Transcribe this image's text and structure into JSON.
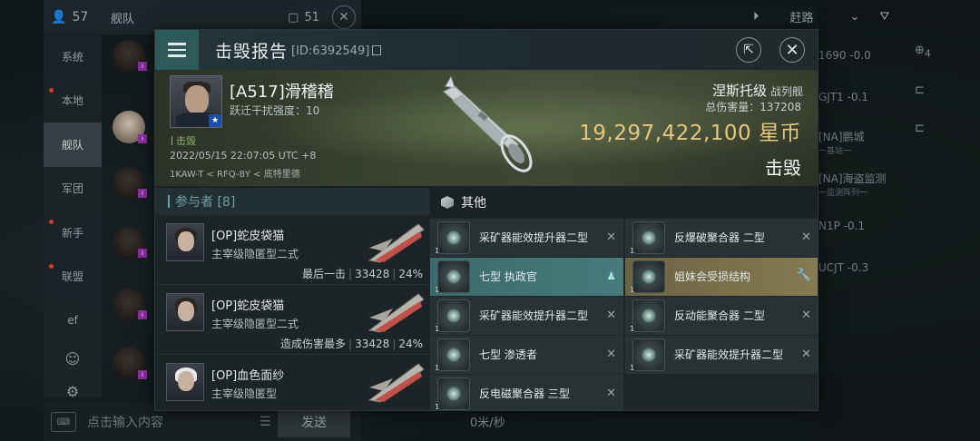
{
  "bg": {
    "player_count": "57",
    "channel": "舰队",
    "unread": "51",
    "nav": [
      "系统",
      "本地",
      "舰队",
      "军团",
      "新手",
      "联盟",
      "ef"
    ],
    "active_nav": "舰队",
    "input_placeholder": "点击输入内容",
    "send": "发送",
    "speed": "0米/秒",
    "route_label": "赶路",
    "right_rows": [
      {
        "main": "1690 -0.0",
        "sub": ""
      },
      {
        "main": "GJT1 -0.1",
        "sub": ""
      },
      {
        "main": "[NA]鹏城",
        "sub": "ー基站一"
      },
      {
        "main": "[NA]海盗监测",
        "sub": "一监测阵列一"
      },
      {
        "main": "N1P -0.1",
        "sub": ""
      },
      {
        "main": "UCJT -0.3",
        "sub": ""
      }
    ],
    "right_side_count": "4"
  },
  "report": {
    "title": "击毁报告",
    "id": "[ID:6392549]",
    "pilot_name": "[A517]滑稽稽",
    "warp_disrupt": "跃迁干扰强度：10",
    "status_tag": "击毁",
    "datetime": "2022/05/15 22:07:05 UTC +8",
    "location": "1KAW-T < RFQ-8Y < 底特里德",
    "ship_name": "涅斯托级",
    "ship_class": "战列舰",
    "total_damage": "总伤害量：137208",
    "isk_value": "19,297,422,100 星币",
    "result": "击毁"
  },
  "participants": {
    "header": "参与者 [8]",
    "rows": [
      {
        "name": "[OP]蛇皮袋猫",
        "ship": "主宰级隐匿型二式",
        "stat_label": "最后一击",
        "damage": "33428",
        "percent": "24%",
        "avatar": "dark"
      },
      {
        "name": "[OP]蛇皮袋猫",
        "ship": "主宰级隐匿型二式",
        "stat_label": "造成伤害最多",
        "damage": "33428",
        "percent": "24%",
        "avatar": "dark"
      },
      {
        "name": "[OP]血色面纱",
        "ship": "主宰级隐匿型",
        "stat_label": "",
        "damage": "",
        "percent": "",
        "avatar": "white"
      }
    ]
  },
  "others": {
    "header": "其他",
    "items": [
      {
        "label": "采矿器能效提升器二型",
        "qty": "1",
        "state": "destroyed",
        "action": "✕"
      },
      {
        "label": "反爆破聚合器 二型",
        "qty": "1",
        "state": "destroyed",
        "action": "✕"
      },
      {
        "label": "七型 执政官",
        "qty": "1",
        "state": "teal",
        "action": "person"
      },
      {
        "label": "姐妹会受损结构",
        "qty": "1",
        "state": "gold",
        "action": "wrench"
      },
      {
        "label": "采矿器能效提升器二型",
        "qty": "1",
        "state": "destroyed",
        "action": "✕"
      },
      {
        "label": "反动能聚合器 二型",
        "qty": "1",
        "state": "destroyed",
        "action": "✕"
      },
      {
        "label": "七型 渗透者",
        "qty": "1",
        "state": "destroyed",
        "action": "✕"
      },
      {
        "label": "采矿器能效提升器二型",
        "qty": "1",
        "state": "destroyed",
        "action": "✕"
      },
      {
        "label": "反电磁聚合器 三型",
        "qty": "1",
        "state": "destroyed",
        "action": "✕"
      },
      {
        "label": "",
        "qty": "",
        "state": "blank",
        "action": ""
      }
    ]
  },
  "colors": {
    "accent_teal": "#477a7c",
    "accent_gold": "#857a50",
    "isk_gold": "#e9c77a"
  }
}
